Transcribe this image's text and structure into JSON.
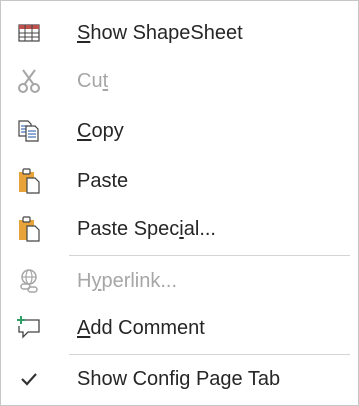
{
  "menu": {
    "items": [
      {
        "label": "Show ShapeSheet",
        "accel_index": 0,
        "enabled": true,
        "icon": "shapesheet-icon"
      },
      {
        "label": "Cut",
        "accel_index": 2,
        "enabled": false,
        "icon": "scissors-icon"
      },
      {
        "label": "Copy",
        "accel_index": 0,
        "enabled": true,
        "icon": "copy-icon"
      },
      {
        "label": "Paste",
        "accel_index": -1,
        "enabled": true,
        "icon": "paste-icon"
      },
      {
        "label": "Paste Special...",
        "accel_index": 10,
        "enabled": true,
        "icon": "paste-special-icon"
      },
      {
        "label": "Hyperlink...",
        "accel_index": 1,
        "enabled": false,
        "icon": "hyperlink-icon"
      },
      {
        "label": "Add Comment",
        "accel_index": 0,
        "enabled": true,
        "icon": "add-comment-icon"
      },
      {
        "label": "Show Config Page Tab",
        "accel_index": -1,
        "enabled": true,
        "checked": true,
        "icon": "checkmark-icon"
      }
    ]
  },
  "colors": {
    "text": "#262626",
    "disabled_text": "#a6a6a6",
    "clipboard_orange": "#e8a33a",
    "icon_blue": "#3f6fb6",
    "comment_green": "#2e9e62",
    "border": "#c6c6c6"
  }
}
